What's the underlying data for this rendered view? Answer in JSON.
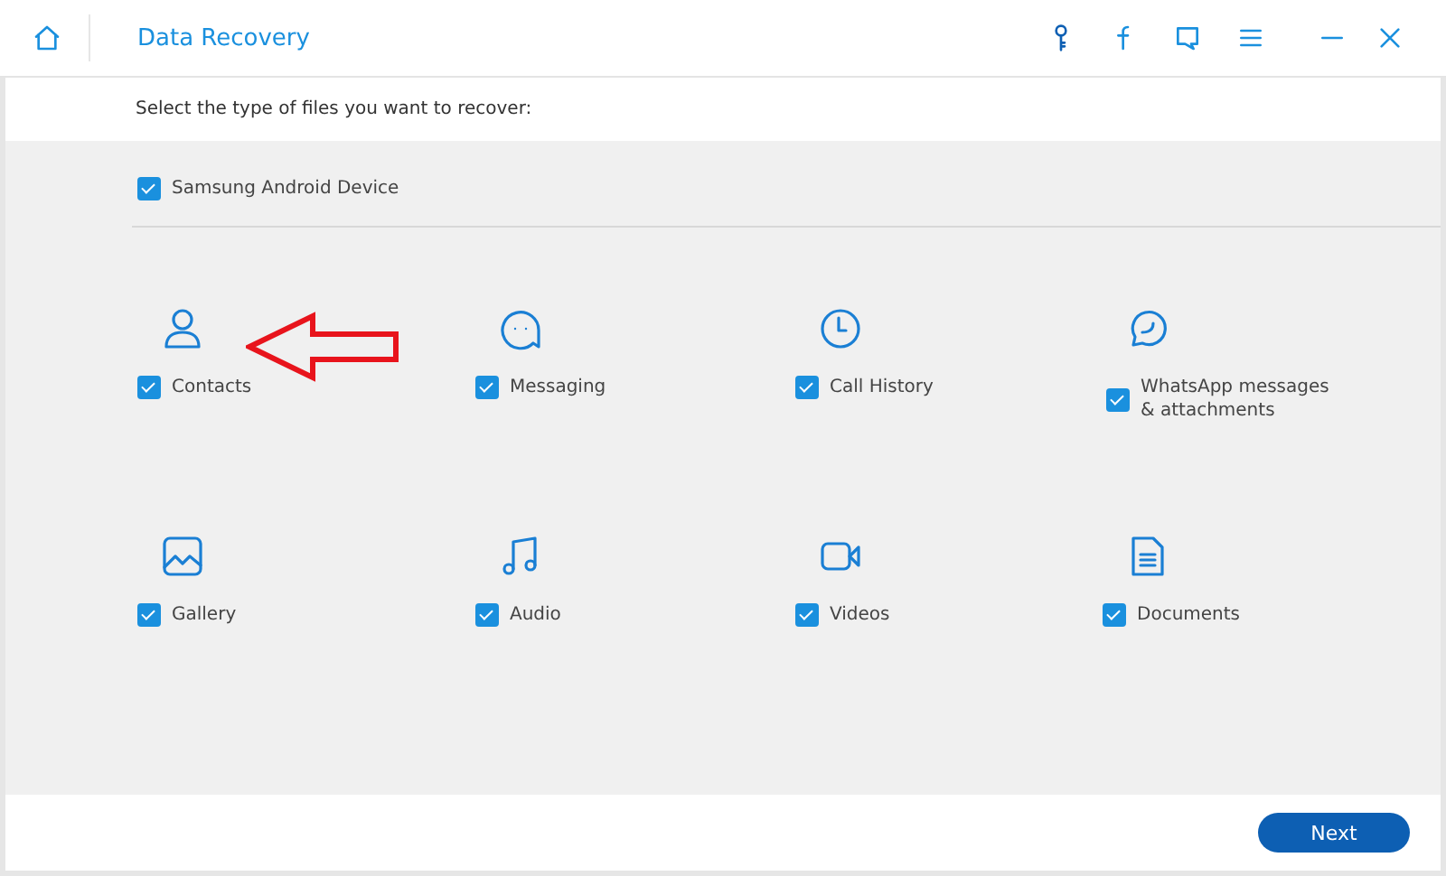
{
  "window": {
    "title": "Data Recovery"
  },
  "instruction": "Select the type of files you want to recover:",
  "device": {
    "label": "Samsung Android Device",
    "checked": true
  },
  "file_types": [
    {
      "kind": "contacts",
      "label": "Contacts",
      "checked": true
    },
    {
      "kind": "messaging",
      "label": "Messaging",
      "checked": true
    },
    {
      "kind": "call-history",
      "label": "Call History",
      "checked": true
    },
    {
      "kind": "whatsapp",
      "label": "WhatsApp messages\n& attachments",
      "checked": true
    },
    {
      "kind": "gallery",
      "label": "Gallery",
      "checked": true
    },
    {
      "kind": "audio",
      "label": "Audio",
      "checked": true
    },
    {
      "kind": "videos",
      "label": "Videos",
      "checked": true
    },
    {
      "kind": "documents",
      "label": "Documents",
      "checked": true
    }
  ],
  "annotation": {
    "kind": "arrow"
  },
  "buttons": [
    {
      "label": "Next"
    }
  ]
}
